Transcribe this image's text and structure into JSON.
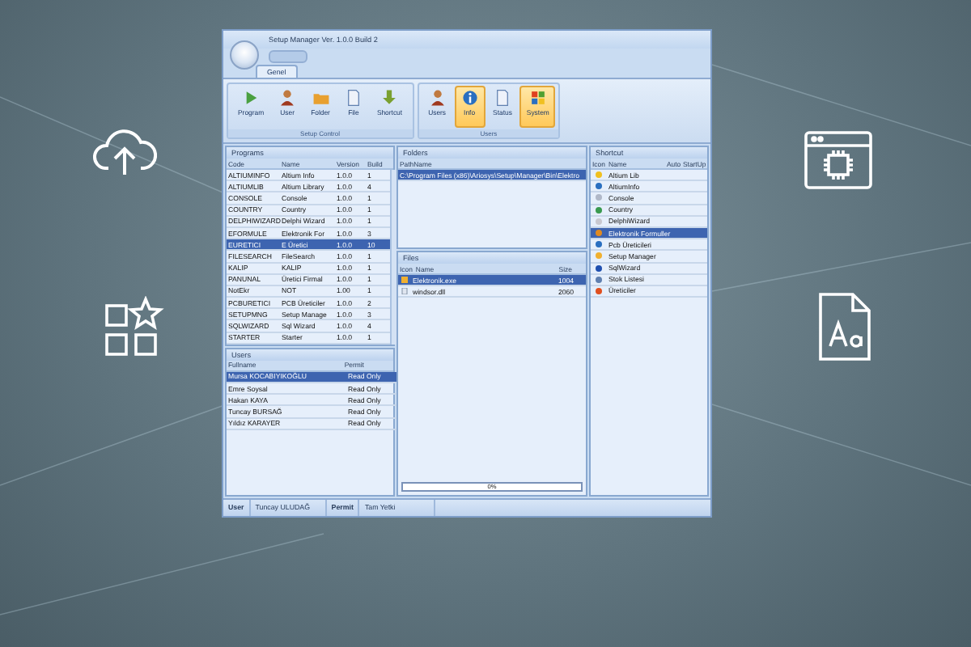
{
  "window": {
    "title": "Setup Manager Ver. 1.0.0 Build 2"
  },
  "ribbon": {
    "tabs": [
      {
        "label": "Genel",
        "selected": true
      }
    ],
    "groups": [
      {
        "label": "Setup Control",
        "buttons": [
          {
            "label": "Program",
            "kind": "play",
            "active": false
          },
          {
            "label": "User",
            "kind": "person",
            "active": false
          },
          {
            "label": "Folder",
            "kind": "folder",
            "active": false
          },
          {
            "label": "File",
            "kind": "file",
            "active": false
          },
          {
            "label": "Shortcut",
            "kind": "arrow",
            "active": false
          }
        ]
      },
      {
        "label": "Users",
        "buttons": [
          {
            "label": "Users",
            "kind": "person",
            "active": false
          },
          {
            "label": "Info",
            "kind": "info",
            "active": true
          },
          {
            "label": "Status",
            "kind": "file",
            "active": false
          },
          {
            "label": "System",
            "kind": "windows",
            "active": true
          }
        ]
      }
    ]
  },
  "programs": {
    "title": "Programs",
    "columns": [
      "Code",
      "Name",
      "Version",
      "Build"
    ],
    "rows": [
      {
        "cells": [
          "ALTIUMINFO",
          "Altium Info",
          "1.0.0",
          "1"
        ],
        "selected": false
      },
      {
        "cells": [
          "ALTIUMLIB",
          "Altium Library",
          "1.0.0",
          "4"
        ],
        "selected": false
      },
      {
        "cells": [
          "CONSOLE",
          "Console",
          "1.0.0",
          "1"
        ],
        "selected": false
      },
      {
        "cells": [
          "COUNTRY",
          "Country",
          "1.0.0",
          "1"
        ],
        "selected": false
      },
      {
        "cells": [
          "DELPHIWIZARD",
          "Delphi Wizard",
          "1.0.0",
          "1"
        ],
        "selected": false
      },
      {
        "cells": [
          "EFORMULE",
          "Elektronik For",
          "1.0.0",
          "3"
        ],
        "selected": false
      },
      {
        "cells": [
          "EURETICI",
          "E Üretici",
          "1.0.0",
          "10"
        ],
        "selected": true
      },
      {
        "cells": [
          "FILESEARCH",
          "FileSearch",
          "1.0.0",
          "1"
        ],
        "selected": false
      },
      {
        "cells": [
          "KALIP",
          "KALIP",
          "1.0.0",
          "1"
        ],
        "selected": false
      },
      {
        "cells": [
          "PANUNAL",
          "Üretici Firmal",
          "1.0.0",
          "1"
        ],
        "selected": false
      },
      {
        "cells": [
          "NotEkr",
          "NOT",
          "1.00",
          "1"
        ],
        "selected": false
      },
      {
        "cells": [
          "PCBURETICI",
          "PCB Üreticiler",
          "1.0.0",
          "2"
        ],
        "selected": false
      },
      {
        "cells": [
          "SETUPMNG",
          "Setup Manage",
          "1.0.0",
          "3"
        ],
        "selected": false
      },
      {
        "cells": [
          "SQLWIZARD",
          "Sql Wizard",
          "1.0.0",
          "4"
        ],
        "selected": false
      },
      {
        "cells": [
          "STARTER",
          "Starter",
          "1.0.0",
          "1"
        ],
        "selected": false
      }
    ]
  },
  "users": {
    "title": "Users",
    "columns": [
      "Fullname",
      "Permit"
    ],
    "rows": [
      {
        "cells": [
          "Mursa KOCABIYIKOĞLU",
          "Read Only"
        ],
        "selected": true
      },
      {
        "cells": [
          "Emre Soysal",
          "Read Only"
        ],
        "selected": false
      },
      {
        "cells": [
          "Hakan KAYA",
          "Read Only"
        ],
        "selected": false
      },
      {
        "cells": [
          "Tuncay BURSAĞ",
          "Read Only"
        ],
        "selected": false
      },
      {
        "cells": [
          "Yıldız KARAYER",
          "Read Only"
        ],
        "selected": false
      }
    ]
  },
  "folders": {
    "title": "Folders",
    "columns": [
      "PathName"
    ],
    "rows": [
      {
        "cells": [
          "C:\\Program Files (x86)\\Ariosys\\Setup\\Manager\\Bin\\Elektro"
        ],
        "selected": true
      }
    ]
  },
  "files": {
    "title": "Files",
    "columns": [
      "Icon",
      "Name",
      "Size"
    ],
    "rows": [
      {
        "kind": "exe",
        "cells": [
          "",
          "Elektronik.exe",
          "1004"
        ],
        "selected": true
      },
      {
        "kind": "dll",
        "cells": [
          "",
          "windsor.dll",
          "2060"
        ],
        "selected": false
      }
    ],
    "progress": {
      "level": 0,
      "reading": "0%"
    }
  },
  "shortcut": {
    "title": "Shortcut",
    "columns": [
      "Icon",
      "Name",
      "Auto",
      "StartUp"
    ],
    "rows": [
      {
        "label": "Altium Lib",
        "color": "#f0c020",
        "selected": false
      },
      {
        "label": "AltiumInfo",
        "color": "#2a6fc0",
        "selected": false
      },
      {
        "label": "Console",
        "color": "#b0b8c8",
        "selected": false
      },
      {
        "label": "Country",
        "color": "#3a9a50",
        "selected": false
      },
      {
        "label": "DelphiWizard",
        "color": "#c8c8d0",
        "selected": false
      },
      {
        "label": "Elektronik Formuller",
        "color": "#e08a20",
        "selected": true
      },
      {
        "label": "Pcb Üreticileri",
        "color": "#2a6fc0",
        "selected": false
      },
      {
        "label": "Setup Manager",
        "color": "#f0b030",
        "selected": false
      },
      {
        "label": "SqlWizard",
        "color": "#2050b0",
        "selected": false
      },
      {
        "label": "Stok Listesi",
        "color": "#6080b0",
        "selected": false
      },
      {
        "label": "Üreticiler",
        "color": "#e05020",
        "selected": false
      }
    ]
  },
  "status_bar": [
    {
      "label": "User",
      "value": "Tuncay ULUDAĞ"
    },
    {
      "label": "Permit",
      "value": "Tam Yetki"
    }
  ]
}
